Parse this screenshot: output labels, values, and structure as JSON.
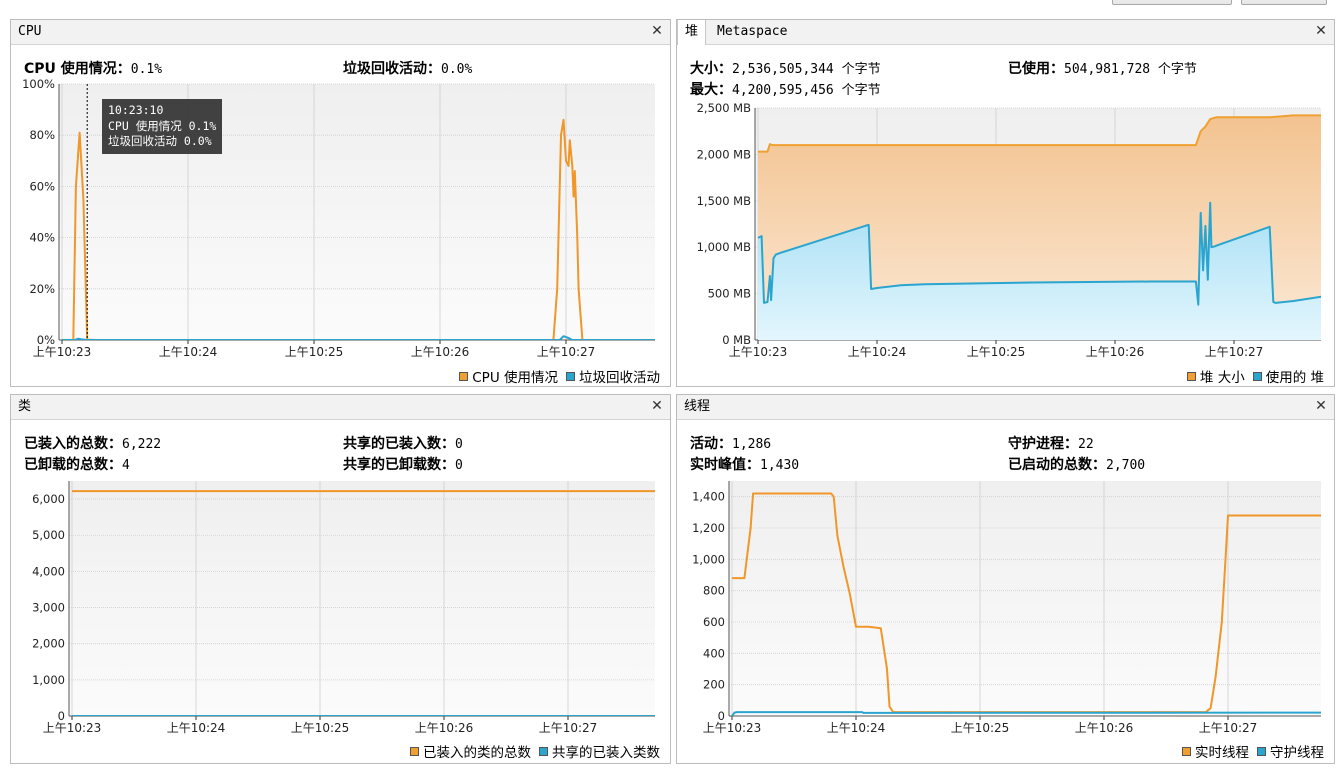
{
  "colors": {
    "orange": "#f0a030",
    "orange_line": "#f19628",
    "blue": "#2aa5cf",
    "orange_fill_top": "#f3c390",
    "orange_fill_bottom": "#fbe9d6",
    "blue_fill_top": "#a8dff5",
    "blue_fill_bottom": "#e3f6fd",
    "plot_bg_top": "#efefef",
    "plot_bg_bottom": "#fbfbfb",
    "grid": "#cfcfcf"
  },
  "cpu": {
    "tab": "CPU",
    "stats": [
      {
        "label": "CPU 使用情况：",
        "value": "0.1%"
      },
      {
        "label": "垃圾回收活动：",
        "value": "0.0%"
      }
    ],
    "tooltip": [
      "10:23:10",
      "CPU 使用情况  0.1%",
      "垃圾回收活动  0.0%"
    ],
    "legend": [
      "CPU 使用情况",
      "垃圾回收活动"
    ]
  },
  "heap": {
    "tabs": [
      "堆",
      "Metaspace"
    ],
    "stats": [
      {
        "label": "大小：",
        "value": "2,536,505,344 个字节"
      },
      {
        "label": "已使用：",
        "value": "504,981,728 个字节"
      },
      {
        "label": "最大：",
        "value": "4,200,595,456 个字节"
      }
    ],
    "legend": [
      "堆 大小",
      "使用的 堆"
    ]
  },
  "classes": {
    "tab": "类",
    "stats": [
      {
        "label": "已装入的总数：",
        "value": "6,222"
      },
      {
        "label": "共享的已装入数：",
        "value": "0"
      },
      {
        "label": "已卸载的总数：",
        "value": "4"
      },
      {
        "label": "共享的已卸载数：",
        "value": "0"
      }
    ],
    "legend": [
      "已装入的类的总数",
      "共享的已装入类数"
    ]
  },
  "threads": {
    "tab": "线程",
    "stats": [
      {
        "label": "活动：",
        "value": "1,286"
      },
      {
        "label": "守护进程：",
        "value": "22"
      },
      {
        "label": "实时峰值：",
        "value": "1,430"
      },
      {
        "label": "已启动的总数：",
        "value": "2,700"
      }
    ],
    "legend": [
      "实时线程",
      "守护线程"
    ]
  },
  "chart_data": [
    {
      "id": "cpu",
      "type": "line",
      "x_ticks": [
        "上午10:23",
        "上午10:24",
        "上午10:25",
        "上午10:26",
        "上午10:27"
      ],
      "x_range_minutes": [
        0,
        4.75
      ],
      "ylim": [
        0,
        100
      ],
      "y_ticks": [
        0,
        20,
        40,
        60,
        80,
        100
      ],
      "y_tick_labels": [
        "0%",
        "20%",
        "40%",
        "60%",
        "80%",
        "100%"
      ],
      "grid": true,
      "cursor_at": 0.2,
      "series": [
        {
          "name": "CPU 使用情况",
          "color_key": "orange_line",
          "x": [
            0,
            0.09,
            0.11,
            0.14,
            0.17,
            0.2,
            0.28,
            3.0,
            3.9,
            3.93,
            3.96,
            3.98,
            4.0,
            4.02,
            4.03,
            4.05,
            4.06,
            4.07,
            4.09,
            4.1,
            4.13,
            4.2,
            4.75
          ],
          "y": [
            0,
            0,
            60,
            81,
            55,
            0.1,
            0,
            0,
            0,
            20,
            80,
            86,
            70,
            68,
            78,
            68,
            56,
            66,
            40,
            20,
            0,
            0,
            0
          ]
        },
        {
          "name": "垃圾回收活动",
          "color_key": "blue",
          "x": [
            0,
            0.1,
            0.13,
            0.15,
            0.2,
            2.0,
            3.95,
            3.98,
            4.02,
            4.05,
            4.75
          ],
          "y": [
            0,
            0,
            0.5,
            0.3,
            0,
            0,
            0,
            1.5,
            0.8,
            0,
            0
          ]
        }
      ]
    },
    {
      "id": "heap",
      "type": "area",
      "x_ticks": [
        "上午10:23",
        "上午10:24",
        "上午10:25",
        "上午10:26",
        "上午10:27"
      ],
      "x_range_minutes": [
        0,
        4.75
      ],
      "ylim": [
        0,
        2500
      ],
      "y_ticks": [
        0,
        500,
        1000,
        1500,
        2000,
        2500
      ],
      "y_tick_labels": [
        "0 MB",
        "500 MB",
        "1,000 MB",
        "1,500 MB",
        "2,000 MB",
        "2,500 MB"
      ],
      "grid": true,
      "series": [
        {
          "name": "堆 大小",
          "color_key": "orange",
          "x": [
            0,
            0.08,
            0.1,
            0.12,
            3.68,
            3.72,
            3.76,
            3.8,
            3.85,
            4.0,
            4.3,
            4.5,
            4.75
          ],
          "y": [
            2030,
            2030,
            2110,
            2100,
            2100,
            2250,
            2300,
            2380,
            2400,
            2400,
            2400,
            2420,
            2420
          ]
        },
        {
          "name": "使用的 堆",
          "color_key": "blue",
          "x": [
            0,
            0.03,
            0.05,
            0.08,
            0.1,
            0.11,
            0.13,
            0.15,
            0.19,
            0.9,
            0.93,
            0.95,
            1.0,
            1.2,
            1.4,
            2.3,
            3.3,
            3.68,
            3.7,
            3.72,
            3.74,
            3.76,
            3.78,
            3.8,
            3.81,
            3.84,
            3.86,
            4.3,
            4.33,
            4.35,
            4.5,
            4.75
          ],
          "y": [
            1100,
            1120,
            400,
            410,
            690,
            430,
            880,
            920,
            940,
            1230,
            1240,
            550,
            560,
            590,
            600,
            620,
            630,
            630,
            380,
            1370,
            750,
            1230,
            650,
            1480,
            1000,
            1010,
            1020,
            1220,
            410,
            400,
            420,
            470
          ]
        }
      ]
    },
    {
      "id": "classes",
      "type": "line",
      "x_ticks": [
        "上午10:23",
        "上午10:24",
        "上午10:25",
        "上午10:26",
        "上午10:27"
      ],
      "x_range_minutes": [
        0,
        4.75
      ],
      "ylim": [
        0,
        6500
      ],
      "y_ticks": [
        0,
        1000,
        2000,
        3000,
        4000,
        5000,
        6000
      ],
      "y_tick_labels": [
        "0",
        "1,000",
        "2,000",
        "3,000",
        "4,000",
        "5,000",
        "6,000"
      ],
      "grid": true,
      "series": [
        {
          "name": "已装入的类的总数",
          "color_key": "orange_line",
          "x": [
            0,
            4.75
          ],
          "y": [
            6222,
            6222
          ]
        },
        {
          "name": "共享的已装入类数",
          "color_key": "blue",
          "x": [
            0,
            4.75
          ],
          "y": [
            0,
            0
          ]
        }
      ]
    },
    {
      "id": "threads",
      "type": "line",
      "x_ticks": [
        "上午10:23",
        "上午10:24",
        "上午10:25",
        "上午10:26",
        "上午10:27"
      ],
      "x_range_minutes": [
        0,
        4.75
      ],
      "ylim": [
        0,
        1500
      ],
      "y_ticks": [
        0,
        200,
        400,
        600,
        800,
        1000,
        1200,
        1400
      ],
      "y_tick_labels": [
        "0",
        "200",
        "400",
        "600",
        "800",
        "1,000",
        "1,200",
        "1,400"
      ],
      "grid": true,
      "series": [
        {
          "name": "实时线程",
          "color_key": "orange_line",
          "x": [
            0,
            0.1,
            0.15,
            0.17,
            0.2,
            0.8,
            0.82,
            0.85,
            0.9,
            0.95,
            1.0,
            1.1,
            1.2,
            1.25,
            1.27,
            1.3,
            2.0,
            3.5,
            3.82,
            3.86,
            3.9,
            3.95,
            3.98,
            4.0,
            4.1,
            4.75
          ],
          "y": [
            880,
            880,
            1200,
            1420,
            1420,
            1420,
            1400,
            1150,
            950,
            780,
            570,
            570,
            560,
            300,
            60,
            25,
            25,
            25,
            25,
            50,
            250,
            600,
            1000,
            1280,
            1280,
            1280
          ]
        },
        {
          "name": "守护线程",
          "color_key": "blue",
          "x": [
            0,
            0.02,
            0.04,
            1.05,
            1.06,
            4.75
          ],
          "y": [
            0,
            22,
            25,
            25,
            20,
            22
          ]
        }
      ]
    }
  ]
}
